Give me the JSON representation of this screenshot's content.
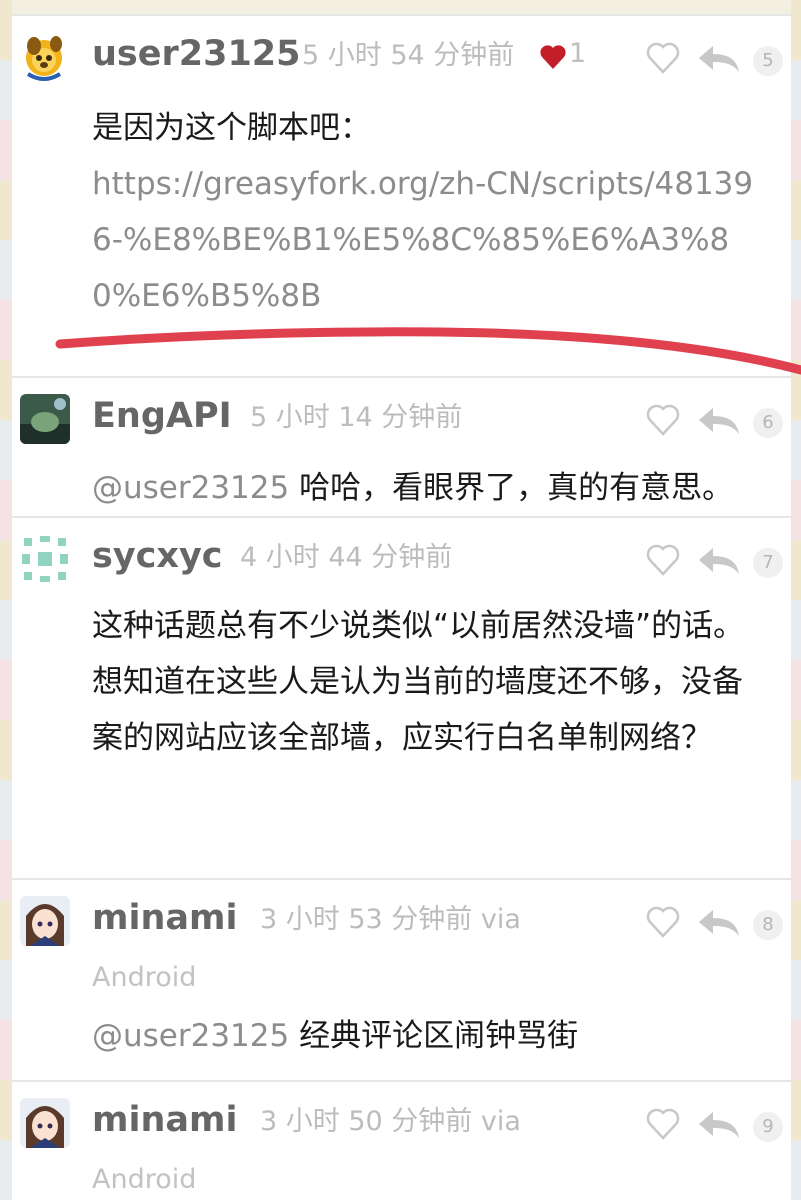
{
  "replies": [
    {
      "username": "user23125",
      "time": "5 小时 54 分钟前",
      "liked_count": "1",
      "floor": "5",
      "content_text": "是因为这个脚本吧：",
      "content_link": "https://greasyfork.org/zh-CN/scripts/481396-%E8%BE%B1%E5%8C%85%E6%A3%80%E6%B5%8B"
    },
    {
      "username": "EngAPI",
      "time": "5 小时 14 分钟前",
      "floor": "6",
      "mention": "@user23125",
      "content_text": " 哈哈，看眼界了，真的有意思。"
    },
    {
      "username": "sycxyc",
      "time": "4 小时 44 分钟前",
      "floor": "7",
      "content_line1": "这种话题总有不少说类似“以前居然没墙”的话。",
      "content_line2": "想知道在这些人是认为当前的墙度还不够，没备案的网站应该全部墙，应实行白名单制网络？"
    },
    {
      "username": "minami",
      "time": "3 小时 53 分钟前 via",
      "time_cont": "Android",
      "floor": "8",
      "mention": "@user23125",
      "content_text": " 经典评论区闹钟骂街"
    },
    {
      "username": "minami",
      "time": "3 小时 50 分钟前 via",
      "time_cont": "Android",
      "floor": "9"
    }
  ],
  "colors": {
    "heart_red": "#c41e2a",
    "annotation_red": "#e0414e"
  }
}
